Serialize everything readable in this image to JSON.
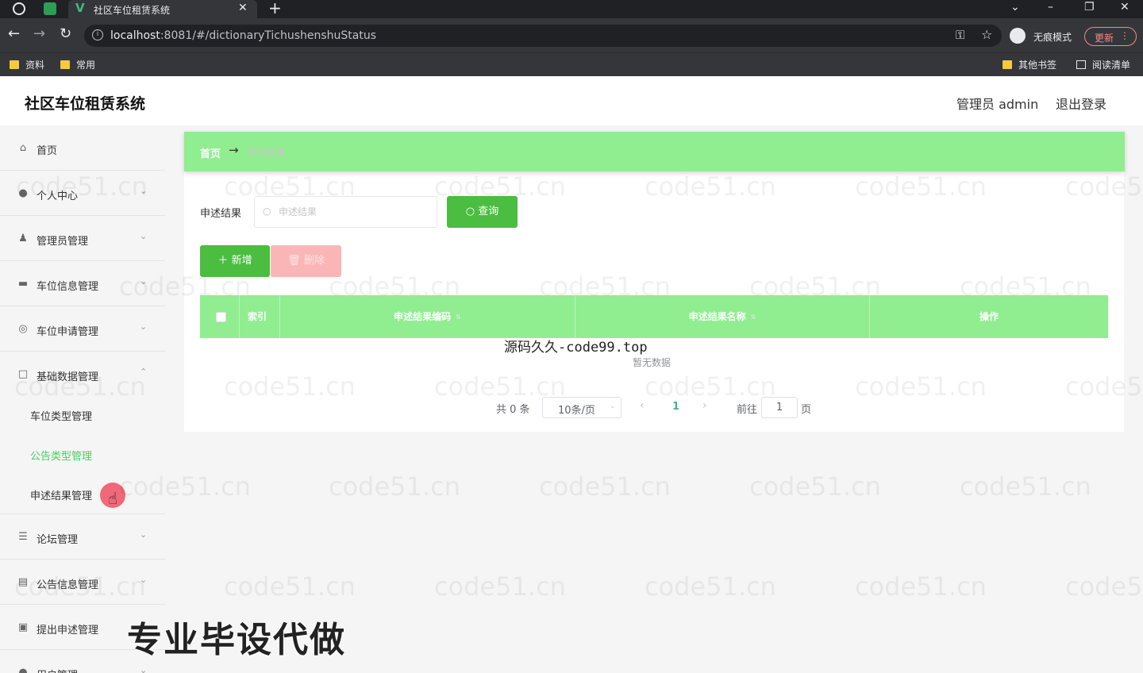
{
  "browser": {
    "tab_title": "社区车位租赁系统",
    "url_host": "localhost",
    "url_rest": ":8081/#/dictionaryTichushenshuStatus",
    "incognito_label": "无痕模式",
    "update_label": "更新",
    "bookmarks": [
      "资料",
      "常用"
    ],
    "bookmarks_right": [
      "其他书签",
      "阅读清单"
    ]
  },
  "app": {
    "title": "社区车位租赁系统",
    "user": "管理员 admin",
    "logout": "退出登录"
  },
  "menu": [
    {
      "label": "首页",
      "icon": "home-icon"
    },
    {
      "label": "个人中心",
      "icon": "user-icon"
    },
    {
      "label": "管理员管理",
      "icon": "admin-icon"
    },
    {
      "label": "车位信息管理",
      "icon": "car-icon"
    },
    {
      "label": "车位申请管理",
      "icon": "compass-icon"
    },
    {
      "label": "基础数据管理",
      "icon": "box-icon"
    },
    {
      "label": "论坛管理",
      "icon": "sliders-icon"
    },
    {
      "label": "公告信息管理",
      "icon": "message-icon"
    },
    {
      "label": "提出申述管理",
      "icon": "clipboard-icon"
    },
    {
      "label": "用户管理",
      "icon": "user-icon"
    }
  ],
  "submenu": [
    "车位类型管理",
    "公告类型管理",
    "申述结果管理"
  ],
  "breadcrumb": {
    "home": "首页",
    "arrow": "→",
    "current": "申述结果"
  },
  "search": {
    "label": "申述结果",
    "placeholder": "申述结果",
    "button": "查询"
  },
  "actions": {
    "add": "新增",
    "delete": "删除"
  },
  "table": {
    "headers": [
      "索引",
      "申述结果编码",
      "申述结果名称",
      "操作"
    ],
    "empty": "暂无数据"
  },
  "pagination": {
    "total": "共 0 条",
    "page_size": "10条/页",
    "current_page": "1",
    "goto_label": "前往",
    "goto_value": "1",
    "page_suffix": "页"
  },
  "overlay": {
    "site": "源码久久-code99.top",
    "ad": "专业毕设代做",
    "watermark": "code51.cn"
  },
  "colors": {
    "accent_green": "#90ee90",
    "button_green": "#4bbd40",
    "danger_light": "#fab6b6",
    "active_menu": "#42d162"
  }
}
